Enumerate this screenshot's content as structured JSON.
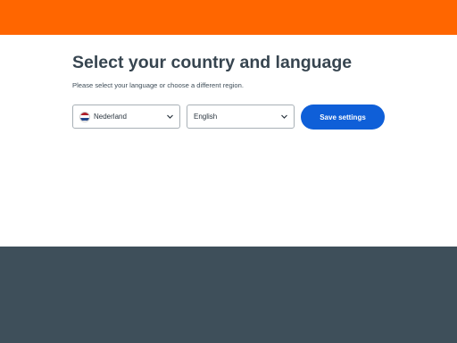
{
  "header": {
    "accent_color": "#ff6600"
  },
  "main": {
    "title": "Select your country and language",
    "subtitle": "Please select your language or choose a different region.",
    "country_select": {
      "value": "Nederland",
      "flag": "netherlands-flag-icon",
      "flag_colors": [
        "#ae1c28",
        "#ffffff",
        "#21468b"
      ]
    },
    "language_select": {
      "value": "English"
    },
    "save_label": "Save settings",
    "button_color": "#0f5fd8"
  },
  "footer": {
    "background_color": "#3e4f5a"
  }
}
